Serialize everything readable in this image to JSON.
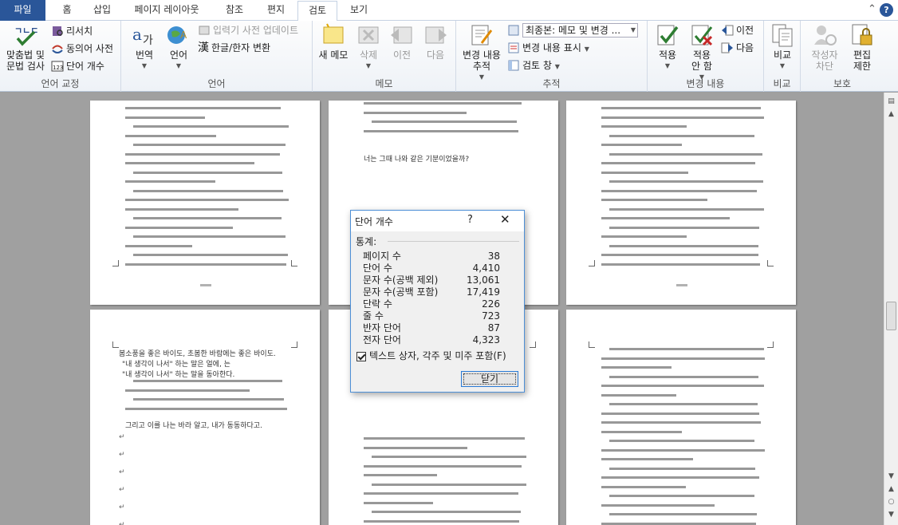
{
  "tabs": [
    {
      "id": "file",
      "label": "파일"
    },
    {
      "id": "home",
      "label": "홈"
    },
    {
      "id": "insert",
      "label": "삽입"
    },
    {
      "id": "layout",
      "label": "페이지 레이아웃"
    },
    {
      "id": "refs",
      "label": "참조"
    },
    {
      "id": "mail",
      "label": "편지"
    },
    {
      "id": "review",
      "label": "검토"
    },
    {
      "id": "view",
      "label": "보기"
    }
  ],
  "ribbon": {
    "proofing": {
      "spell_label_1": "맞춤법 및",
      "spell_label_2": "문법 검사",
      "research": "리서치",
      "thesaurus": "동의어 사전",
      "wordcount": "단어 개수",
      "group": "언어 교정"
    },
    "language": {
      "translate": "번역",
      "language": "언어",
      "ime_update": "입력기 사전 업데이트",
      "hanja": "한글/한자 변환",
      "hanja_glyph": "漢",
      "group": "언어"
    },
    "comments": {
      "new": "새 메모",
      "delete": "삭제",
      "prev": "이전",
      "next": "다음",
      "group": "메모"
    },
    "tracking": {
      "track_1": "변경 내용",
      "track_2": "추적",
      "display_mode": "최종본: 메모 및 변경 ...",
      "show_markup": "변경 내용 표시",
      "review_pane": "검토 창",
      "group": "추적"
    },
    "changes": {
      "accept": "적용",
      "reject_1": "적용",
      "reject_2": "안 함",
      "prev": "이전",
      "next": "다음",
      "group": "변경 내용"
    },
    "compare": {
      "compare": "비교",
      "group": "비교"
    },
    "protect": {
      "block_1": "작성자",
      "block_2": "차단",
      "restrict_1": "편집",
      "restrict_2": "제한",
      "group": "보호"
    }
  },
  "dialog": {
    "title": "단어 개수",
    "help": "?",
    "close_x": "✕",
    "stats_label": "통계:",
    "rows": [
      {
        "label": "페이지 수",
        "value": "38"
      },
      {
        "label": "단어 수",
        "value": "4,410"
      },
      {
        "label": "문자 수(공백 제외)",
        "value": "13,061"
      },
      {
        "label": "문자 수(공백 포함)",
        "value": "17,419"
      },
      {
        "label": "단락 수",
        "value": "226"
      },
      {
        "label": "줄 수",
        "value": "723"
      },
      {
        "label": "반자 단어",
        "value": "87"
      },
      {
        "label": "전자 단어",
        "value": "4,323"
      }
    ],
    "checkbox_label": "텍스트 상자, 각주 및 미주 포함(F)",
    "checkbox_checked": true,
    "close_label": "닫기"
  },
  "document": {
    "pages_visible": 6,
    "snippets": {
      "p4_heading": "봄소풍을 좋은 바이도, 초봄한 바람에는 좋은 바이도.",
      "p4_q1": "\"내 생각이 나서\" 하는 말은 얼에, 는",
      "p4_q2": "\"내 생각이 나서\" 하는 말을 동아한다.",
      "p2_question": "너는 그때 나와 같은 기분이었을까?",
      "p4_end": "그리고 이를 나는 바라 알고, 내가 동동하다고."
    }
  },
  "colors": {
    "file_tab": "#2a5699",
    "accent": "#4d8fd6",
    "doc_bg": "#a0a0a0"
  }
}
